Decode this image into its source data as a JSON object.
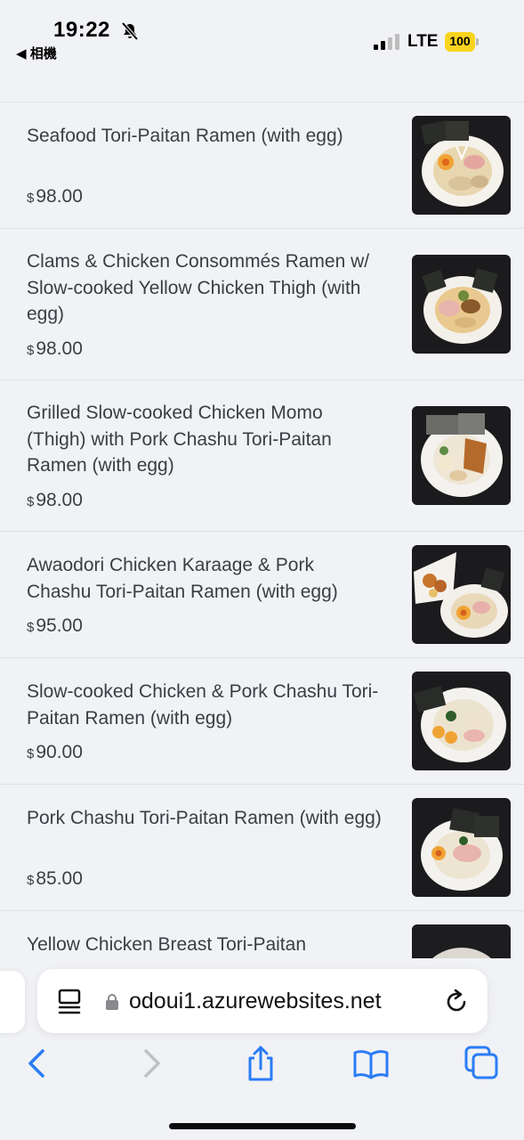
{
  "status_bar": {
    "time": "19:22",
    "back_app": "◀ 相機",
    "network": "LTE",
    "battery": "100",
    "battery_color": "#f8d41f"
  },
  "menu": {
    "currency_symbol": "$",
    "items": [
      {
        "name": "Seafood Tori-Paitan Ramen (with egg)",
        "price": "98.00"
      },
      {
        "name": "Clams & Chicken Consommés Ramen w/ Slow-cooked Yellow Chicken Thigh (with egg)",
        "price": "98.00"
      },
      {
        "name": "Grilled Slow-cooked Chicken Momo (Thigh) with Pork Chashu Tori-Paitan Ramen (with egg)",
        "price": "98.00"
      },
      {
        "name": "Awaodori Chicken Karaage & Pork Chashu Tori-Paitan Ramen (with egg)",
        "price": "95.00"
      },
      {
        "name": "Slow-cooked Chicken & Pork Chashu Tori-Paitan Ramen (with egg)",
        "price": "90.00"
      },
      {
        "name": "Pork Chashu Tori-Paitan Ramen (with egg)",
        "price": "85.00"
      },
      {
        "name": "Yellow Chicken Breast Tori-Paitan",
        "price": ""
      }
    ]
  },
  "browser": {
    "url": "odoui1.azurewebsites.net",
    "icons": [
      "reader-icon",
      "lock-icon",
      "reload-icon",
      "back-icon",
      "forward-icon",
      "share-icon",
      "bookmarks-icon",
      "tabs-icon"
    ],
    "accent_color": "#2a7cf6"
  }
}
